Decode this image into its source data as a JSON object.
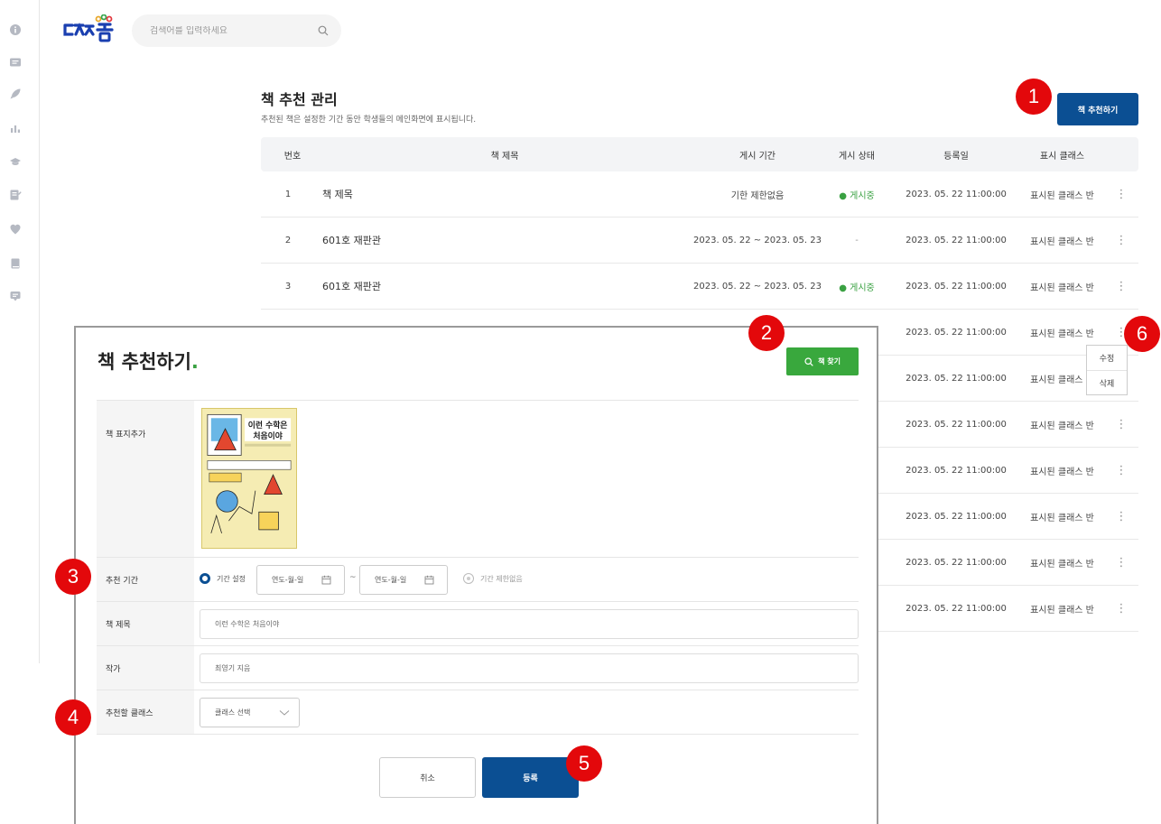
{
  "header": {
    "search": {
      "placeholder": "검색어를 입력하세요"
    }
  },
  "rail": {
    "icons": [
      "info-icon",
      "board-icon",
      "rocket-icon",
      "chart-icon",
      "graduation-cap-icon",
      "edit-note-icon",
      "heart-icon",
      "book-icon",
      "chat-icon"
    ]
  },
  "page": {
    "title": "책 추천 관리",
    "description": "추천된 책은 설정한 기간 동안 학생들의 메인화면에 표시됩니다.",
    "recommend_button": "책 추천하기"
  },
  "table": {
    "columns": [
      "번호",
      "책 제목",
      "게시 기간",
      "게시 상태",
      "등록일",
      "표시 클래스"
    ],
    "rows": [
      {
        "no": "1",
        "title": "책 제목",
        "period": "기한 제한없음",
        "status": "● 게시중",
        "status_on": true,
        "date": "2023. 05. 22 11:00:00",
        "class": "표시된 클래스 반"
      },
      {
        "no": "2",
        "title": "601호 재판관",
        "period": "2023. 05. 22 ~ 2023. 05. 23",
        "status": "-",
        "status_on": false,
        "date": "2023. 05. 22 11:00:00",
        "class": "표시된 클래스 반"
      },
      {
        "no": "3",
        "title": "601호 재판관",
        "period": "2023. 05. 22 ~ 2023. 05. 23",
        "status": "● 게시중",
        "status_on": true,
        "date": "2023. 05. 22 11:00:00",
        "class": "표시된 클래스 반"
      },
      {
        "no": "",
        "title": "",
        "period": "",
        "status": "",
        "status_on": false,
        "date": "2023. 05. 22 11:00:00",
        "class": "표시된 클래스 반"
      },
      {
        "no": "",
        "title": "",
        "period": "",
        "status": "",
        "status_on": false,
        "date": "2023. 05. 22 11:00:00",
        "class": "표시된 클래스 반"
      },
      {
        "no": "",
        "title": "",
        "period": "",
        "status": "",
        "status_on": false,
        "date": "2023. 05. 22 11:00:00",
        "class": "표시된 클래스 반"
      },
      {
        "no": "",
        "title": "",
        "period": "",
        "status": "",
        "status_on": false,
        "date": "2023. 05. 22 11:00:00",
        "class": "표시된 클래스 반"
      },
      {
        "no": "",
        "title": "",
        "period": "",
        "status": "",
        "status_on": false,
        "date": "2023. 05. 22 11:00:00",
        "class": "표시된 클래스 반"
      },
      {
        "no": "",
        "title": "",
        "period": "",
        "status": "",
        "status_on": false,
        "date": "2023. 05. 22 11:00:00",
        "class": "표시된 클래스 반"
      },
      {
        "no": "",
        "title": "",
        "period": "",
        "status": "",
        "status_on": false,
        "date": "2023. 05. 22 11:00:00",
        "class": "표시된 클래스 반"
      }
    ],
    "more_icon": "⋮"
  },
  "context_menu": {
    "edit": "수정",
    "delete": "삭제"
  },
  "modal": {
    "title": "책 추천하기",
    "title_dot": ".",
    "find_button": "책 찾기",
    "fields": {
      "cover_label": "책 표지추가",
      "cover": {
        "title_line1": "이런 수학은",
        "title_line2": "처음이야"
      },
      "period_label": "추천 기간",
      "period_radio": "기간 설정",
      "date_start_placeholder": "연도-월-일",
      "date_end_placeholder": "연도-월-일",
      "date_separator": "~",
      "no_limit_radio": "기간 제한없음",
      "book_title_label": "책 제목",
      "book_title_value": "이런 수학은 처음이야",
      "author_label": "작가",
      "author_value": "최영기 지음",
      "class_label": "추천할 클래스",
      "class_select": "클래스 선택"
    },
    "cancel_button": "취소",
    "submit_button": "등록"
  },
  "markers": [
    "1",
    "2",
    "3",
    "4",
    "5",
    "6"
  ],
  "colors": {
    "primary": "#0b4f93",
    "accent_green": "#39a83d",
    "marker_red": "#e3080b",
    "header_bg": "#f3f4f6"
  }
}
